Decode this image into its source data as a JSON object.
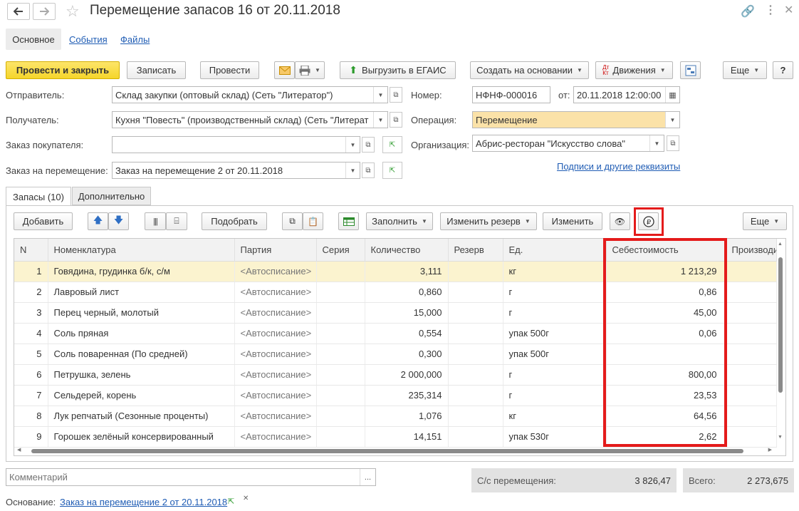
{
  "window": {
    "title": "Перемещение запасов 16 от 20.11.2018"
  },
  "nav_tabs": [
    "Основное",
    "События",
    "Файлы"
  ],
  "toolbar": {
    "post_close": "Провести и закрыть",
    "write": "Записать",
    "post": "Провести",
    "egais": "Выгрузить в ЕГАИС",
    "create_based": "Создать на основании",
    "movements": "Движения",
    "more": "Еще",
    "help": "?"
  },
  "header": {
    "sender_label": "Отправитель:",
    "sender_value": "Склад закупки (оптовый склад) (Сеть \"Литератор\")",
    "receiver_label": "Получатель:",
    "receiver_value": "Кухня \"Повесть\" (производственный склад)  (Сеть \"Литерат",
    "customer_order_label": "Заказ покупателя:",
    "customer_order_value": "",
    "transfer_order_label": "Заказ на перемещение:",
    "transfer_order_value": "Заказ на перемещение 2 от 20.11.2018",
    "number_label": "Номер:",
    "number_value": "НФНФ-000016",
    "date_label": "от:",
    "date_value": "20.11.2018 12:00:00",
    "operation_label": "Операция:",
    "operation_value": "Перемещение",
    "org_label": "Организация:",
    "org_value": "Абрис-ресторан \"Искусство слова\"",
    "signatures_link": "Подписи и другие реквизиты"
  },
  "content_tabs": [
    "Запасы (10)",
    "Дополнительно"
  ],
  "grid_toolbar": {
    "add": "Добавить",
    "pick": "Подобрать",
    "fill": "Заполнить",
    "change_reserve": "Изменить резерв",
    "change": "Изменить",
    "more": "Еще"
  },
  "grid": {
    "columns": [
      "N",
      "Номенклатура",
      "Партия",
      "Серия",
      "Количество",
      "Резерв",
      "Ед.",
      "Себестоимость",
      "Производи"
    ],
    "rows": [
      {
        "n": "1",
        "name": "Говядина, грудинка б/к, с/м",
        "batch": "<Автосписание>",
        "series": "",
        "qty": "3,111",
        "reserve": "",
        "unit": "кг",
        "cost": "1 213,29"
      },
      {
        "n": "2",
        "name": "Лавровый лист",
        "batch": "<Автосписание>",
        "series": "",
        "qty": "0,860",
        "reserve": "",
        "unit": "г",
        "cost": "0,86"
      },
      {
        "n": "3",
        "name": "Перец черный, молотый",
        "batch": "<Автосписание>",
        "series": "",
        "qty": "15,000",
        "reserve": "",
        "unit": "г",
        "cost": "45,00"
      },
      {
        "n": "4",
        "name": "Соль пряная",
        "batch": "<Автосписание>",
        "series": "",
        "qty": "0,554",
        "reserve": "",
        "unit": "упак 500г",
        "cost": "0,06"
      },
      {
        "n": "5",
        "name": "Соль поваренная (По средней)",
        "batch": "<Автосписание>",
        "series": "",
        "qty": "0,300",
        "reserve": "",
        "unit": "упак 500г",
        "cost": ""
      },
      {
        "n": "6",
        "name": "Петрушка, зелень",
        "batch": "<Автосписание>",
        "series": "",
        "qty": "2 000,000",
        "reserve": "",
        "unit": "г",
        "cost": "800,00"
      },
      {
        "n": "7",
        "name": "Сельдерей, корень",
        "batch": "<Автосписание>",
        "series": "",
        "qty": "235,314",
        "reserve": "",
        "unit": "г",
        "cost": "23,53"
      },
      {
        "n": "8",
        "name": "Лук репчатый (Сезонные проценты)",
        "batch": "<Автосписание>",
        "series": "",
        "qty": "1,076",
        "reserve": "",
        "unit": "кг",
        "cost": "64,56"
      },
      {
        "n": "9",
        "name": "Горошек зелёный консервированный",
        "batch": "<Автосписание>",
        "series": "",
        "qty": "14,151",
        "reserve": "",
        "unit": "упак 530г",
        "cost": "2,62"
      }
    ]
  },
  "footer": {
    "comment_placeholder": "Комментарий",
    "cost_label": "С/с перемещения:",
    "cost_value": "3 826,47",
    "total_label": "Всего:",
    "total_value": "2 273,675",
    "basis_label": "Основание:",
    "basis_link": "Заказ на перемещение 2 от 20.11.2018"
  },
  "colors": {
    "primary_button": "#f5d52a",
    "highlight_box": "#e41b1b",
    "selected_row": "#fbf3cf",
    "link": "#1f5cb4"
  }
}
